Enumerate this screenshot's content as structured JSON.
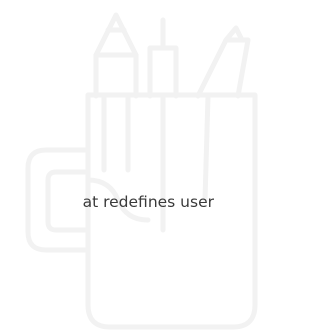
{
  "caption": {
    "text": "at redefines user"
  },
  "illustration": {
    "icon": "pencil-cup-icon",
    "stroke_color": "#f2f2f2",
    "background": "#ffffff",
    "text_color": "#3a3a3a"
  }
}
